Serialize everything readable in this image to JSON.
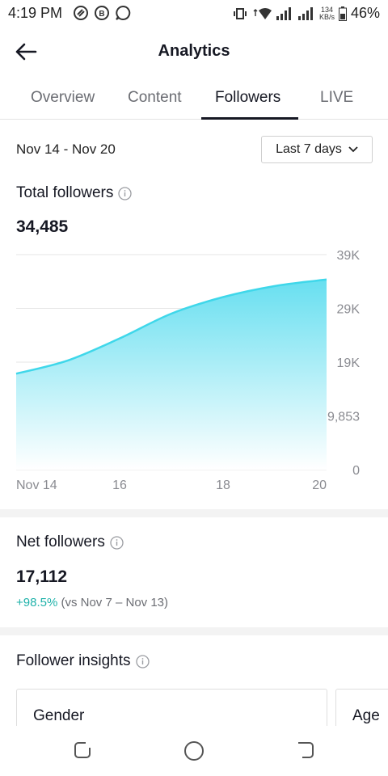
{
  "status_bar": {
    "time": "4:19 PM",
    "net_speed_value": "134",
    "net_speed_unit": "KB/s",
    "battery": "46%"
  },
  "header": {
    "title": "Analytics"
  },
  "tabs": [
    {
      "label": "Overview"
    },
    {
      "label": "Content"
    },
    {
      "label": "Followers"
    },
    {
      "label": "LIVE"
    }
  ],
  "filter": {
    "date_range": "Nov 14 - Nov 20",
    "period": "Last 7 days"
  },
  "total_followers": {
    "title": "Total followers",
    "value": "34,485"
  },
  "chart_data": {
    "type": "area",
    "x": [
      14,
      15,
      16,
      17,
      18,
      19,
      20
    ],
    "x_tick_labels": [
      "Nov 14",
      "16",
      "18",
      "20"
    ],
    "y": [
      17400,
      19800,
      23800,
      28300,
      31300,
      33300,
      34485
    ],
    "y_tick_labels": [
      "39K",
      "29K",
      "19K",
      "9,853",
      "0"
    ],
    "ylim": [
      0,
      39000
    ],
    "grid": true,
    "colors": {
      "line": "#3fd7ea",
      "fill_top": "#67dff0",
      "fill_bottom": "#ffffff"
    }
  },
  "net_followers": {
    "title": "Net followers",
    "value": "17,112",
    "change": "+98.5%",
    "comparison": "(vs Nov 7 – Nov 13)"
  },
  "insights": {
    "title": "Follower insights",
    "cards": [
      "Gender",
      "Age"
    ]
  }
}
